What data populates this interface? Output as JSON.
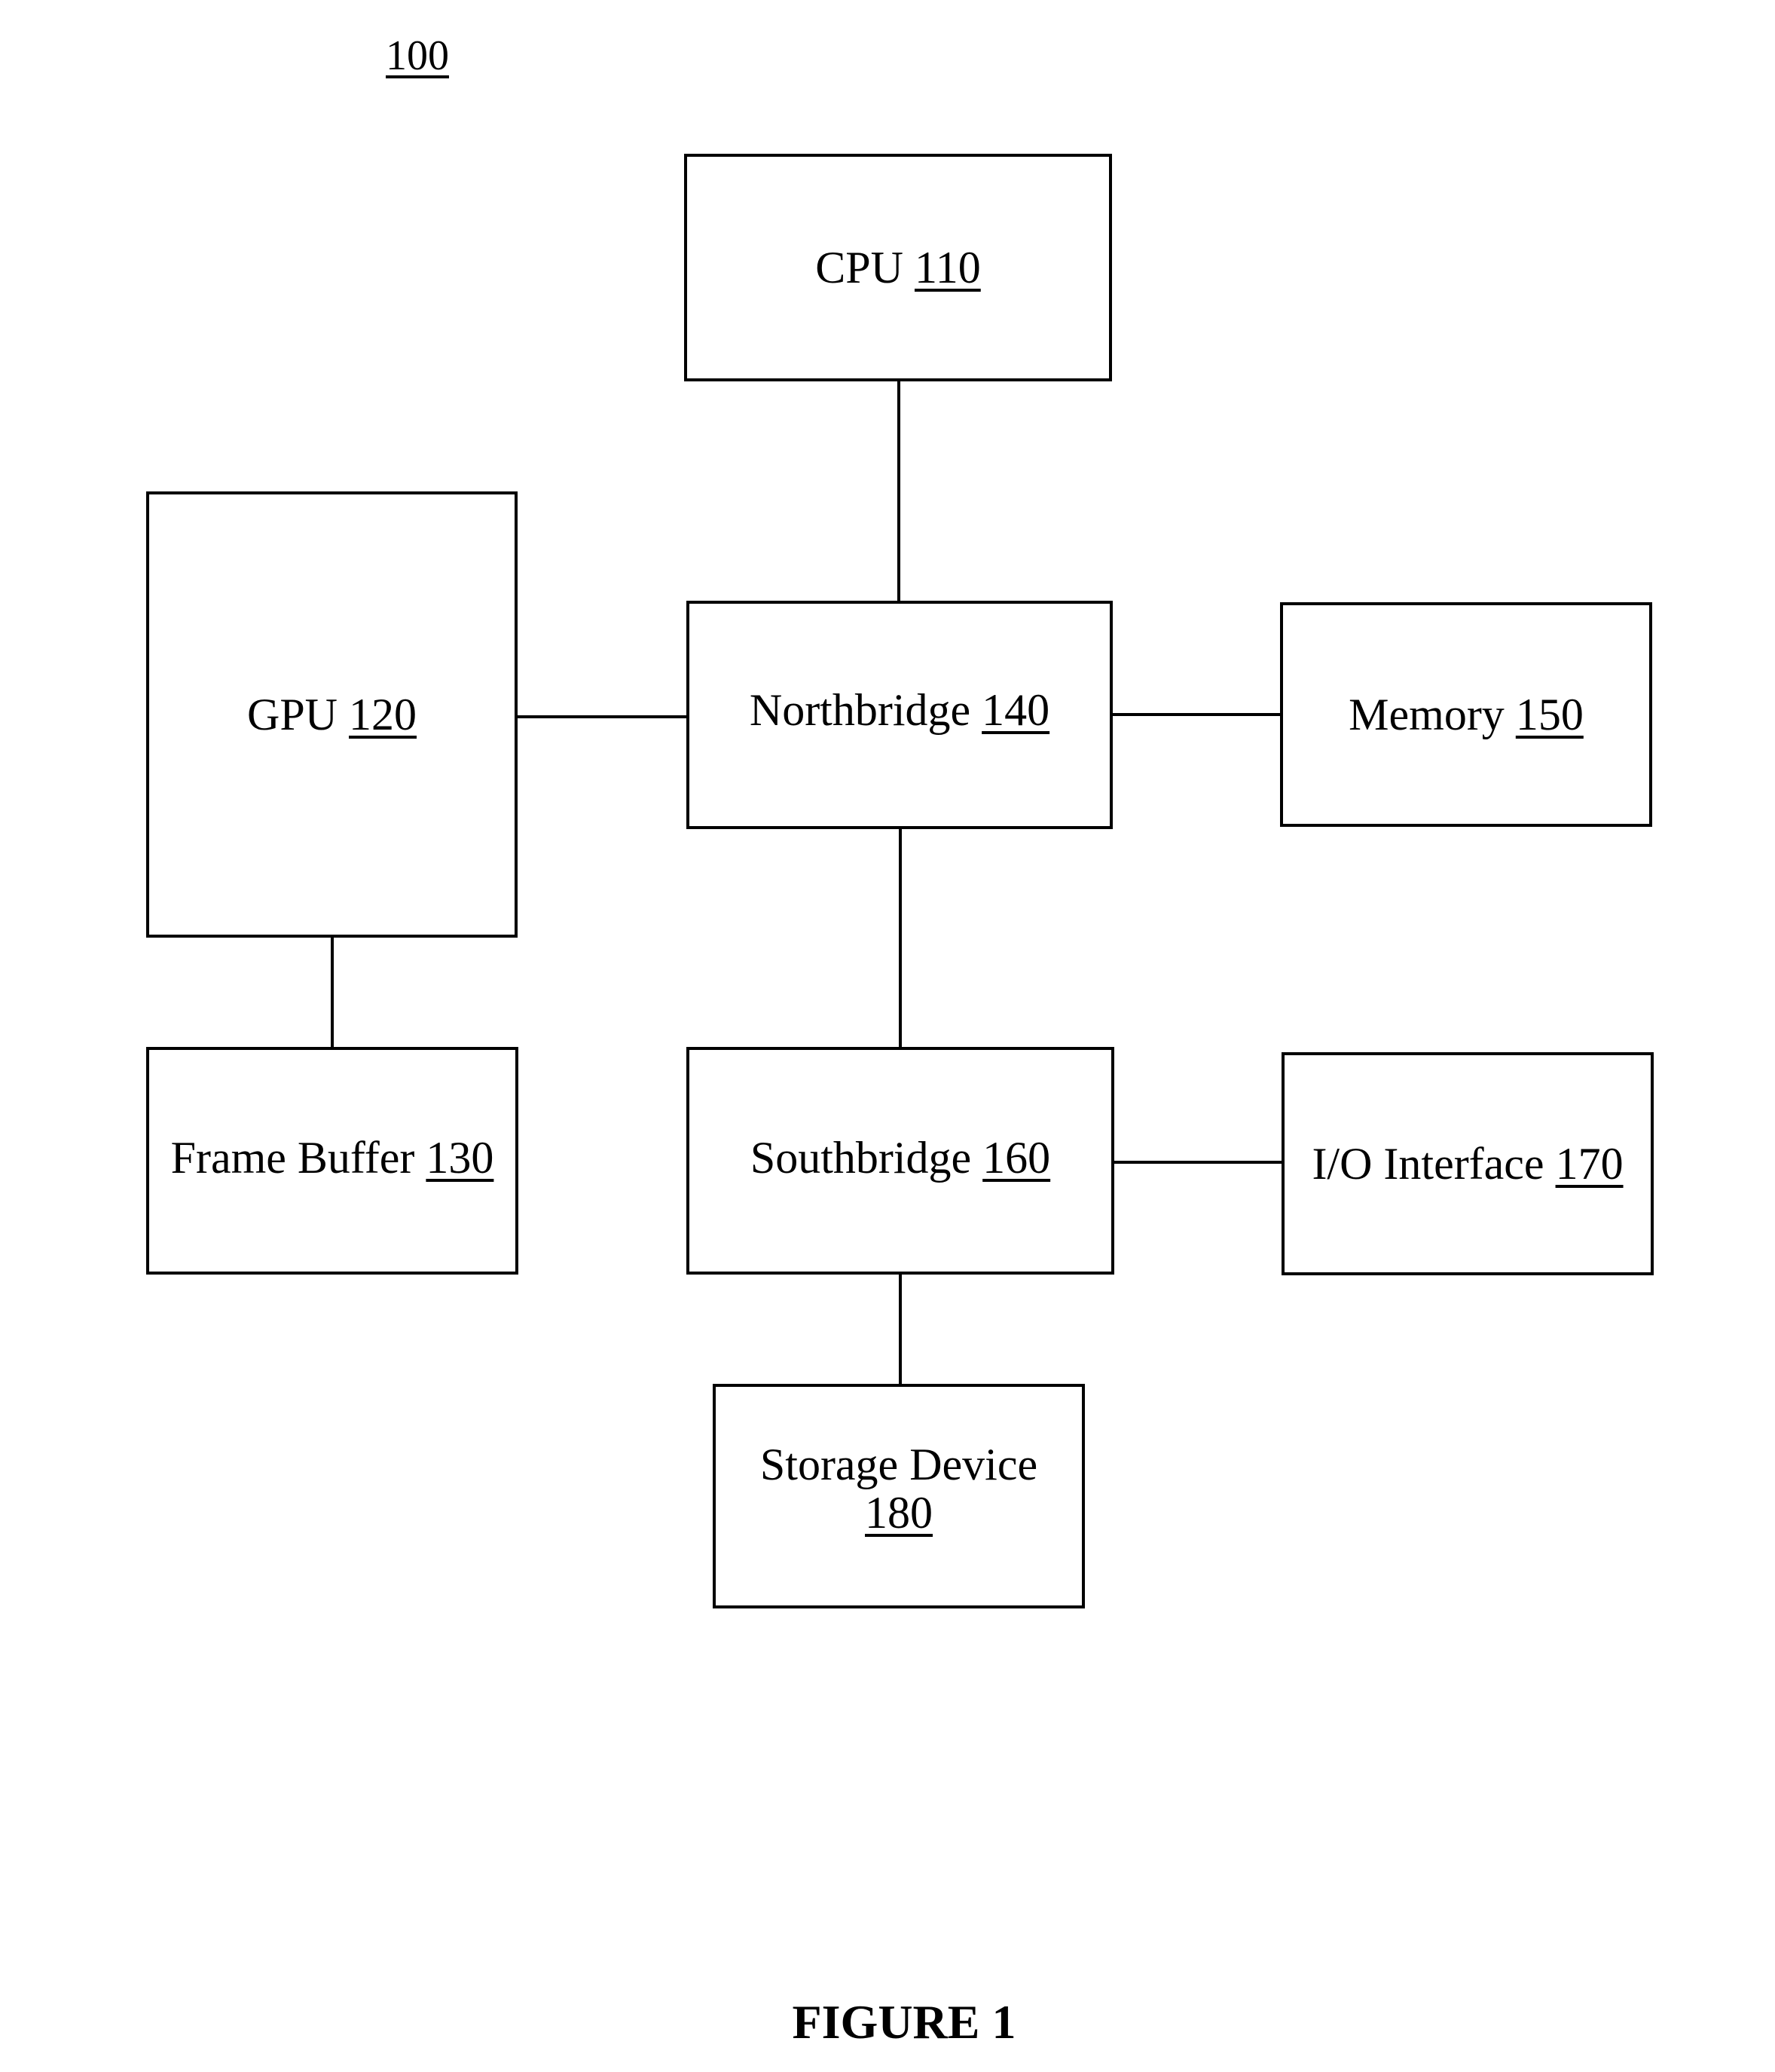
{
  "figure": {
    "reference_label": "100",
    "caption": "FIGURE 1"
  },
  "components": {
    "cpu": {
      "name": "CPU",
      "ref": "110"
    },
    "gpu": {
      "name": "GPU",
      "ref": "120"
    },
    "frame_buffer": {
      "name": "Frame Buffer",
      "ref": "130"
    },
    "northbridge": {
      "name": "Northbridge",
      "ref": "140"
    },
    "memory": {
      "name": "Memory",
      "ref": "150"
    },
    "southbridge": {
      "name": "Southbridge",
      "ref": "160"
    },
    "io_interface": {
      "name": "I/O Interface",
      "ref": "170"
    },
    "storage_device": {
      "name": "Storage Device",
      "ref": "180"
    }
  },
  "connections": [
    {
      "from": "cpu",
      "to": "northbridge"
    },
    {
      "from": "gpu",
      "to": "northbridge"
    },
    {
      "from": "northbridge",
      "to": "memory"
    },
    {
      "from": "northbridge",
      "to": "southbridge"
    },
    {
      "from": "gpu",
      "to": "frame_buffer"
    },
    {
      "from": "southbridge",
      "to": "io_interface"
    },
    {
      "from": "southbridge",
      "to": "storage_device"
    }
  ]
}
